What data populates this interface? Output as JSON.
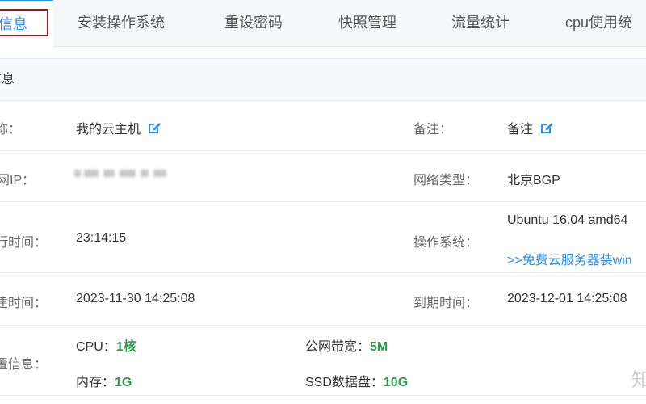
{
  "tabs": [
    {
      "label": "信息",
      "active": true
    },
    {
      "label": "安装操作系统"
    },
    {
      "label": "重设密码"
    },
    {
      "label": "快照管理"
    },
    {
      "label": "流量统计"
    },
    {
      "label": "cpu使用统"
    }
  ],
  "section_title": "信息",
  "rows": {
    "name": {
      "label": "称：",
      "value": "我的云主机",
      "icon": "edit-icon"
    },
    "remark": {
      "label": "备注：",
      "value": "备注",
      "icon": "edit-icon"
    },
    "ip": {
      "label": "网IP：",
      "value": ""
    },
    "network_type": {
      "label": "网络类型：",
      "value": "北京BGP"
    },
    "runtime": {
      "label": "行时间：",
      "value": "23:14:15"
    },
    "os": {
      "label": "操作系统：",
      "value": "Ubuntu 16.04 amd64",
      "link": ">>免费云服务器装win"
    },
    "created": {
      "label": "建时间：",
      "value": "2023-11-30 14:25:08"
    },
    "expire": {
      "label": "到期时间：",
      "value": "2023-12-01 14:25:08"
    },
    "config": {
      "label": "置信息：",
      "cpu_label": "CPU：",
      "cpu_value": "1核",
      "bandwidth_label": "公网带宽：",
      "bandwidth_value": "5M",
      "mem_label": "内存：",
      "mem_value": "1G",
      "disk_label": "SSD数据盘：",
      "disk_value": "10G"
    }
  },
  "watermark": "知",
  "colors": {
    "accent": "#2d8cf0",
    "highlight_border": "#8b1e22",
    "good": "#2e9b4e"
  }
}
